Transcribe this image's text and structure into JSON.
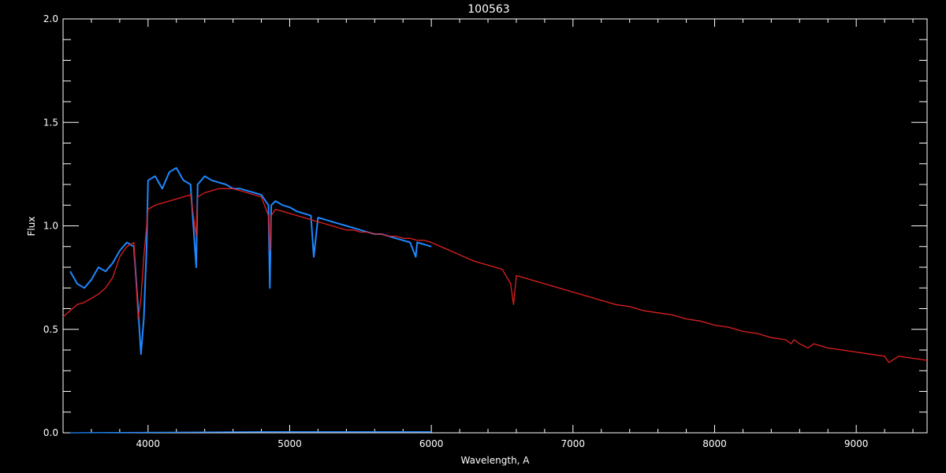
{
  "chart_data": {
    "type": "line",
    "title": "100563",
    "xlabel": "Wavelength, A",
    "ylabel": "Flux",
    "xlim": [
      3400,
      9500
    ],
    "ylim": [
      0.0,
      2.0
    ],
    "xticks": [
      4000,
      5000,
      6000,
      7000,
      8000,
      9000
    ],
    "xtick_labels": [
      "4000",
      "5000",
      "6000",
      "7000",
      "8000",
      "9000"
    ],
    "yticks": [
      0.0,
      0.5,
      1.0,
      1.5,
      2.0
    ],
    "ytick_labels": [
      "0.0",
      "0.5",
      "1.0",
      "1.5",
      "2.0"
    ],
    "grid": false,
    "background": "#000000",
    "axis_color": "#ffffff",
    "series": [
      {
        "color": "#1e88ff",
        "style": "observed spectrum, noisy",
        "x": [
          3450,
          3500,
          3550,
          3600,
          3650,
          3700,
          3750,
          3800,
          3850,
          3900,
          3930,
          3950,
          3970,
          3990,
          4000,
          4050,
          4100,
          4150,
          4200,
          4250,
          4300,
          4340,
          4350,
          4400,
          4450,
          4500,
          4550,
          4600,
          4650,
          4700,
          4750,
          4800,
          4850,
          4860,
          4870,
          4900,
          4950,
          5000,
          5050,
          5100,
          5150,
          5170,
          5200,
          5250,
          5300,
          5350,
          5400,
          5450,
          5500,
          5550,
          5600,
          5650,
          5700,
          5750,
          5800,
          5850,
          5890,
          5900,
          5950,
          6000
        ],
        "y": [
          0.78,
          0.72,
          0.7,
          0.74,
          0.8,
          0.78,
          0.82,
          0.88,
          0.92,
          0.9,
          0.6,
          0.38,
          0.55,
          0.9,
          1.22,
          1.24,
          1.18,
          1.26,
          1.28,
          1.22,
          1.2,
          0.8,
          1.2,
          1.24,
          1.22,
          1.21,
          1.2,
          1.18,
          1.18,
          1.17,
          1.16,
          1.15,
          1.1,
          0.7,
          1.1,
          1.12,
          1.1,
          1.09,
          1.07,
          1.06,
          1.05,
          0.85,
          1.04,
          1.03,
          1.02,
          1.01,
          1.0,
          0.99,
          0.98,
          0.97,
          0.96,
          0.96,
          0.95,
          0.94,
          0.93,
          0.92,
          0.85,
          0.92,
          0.91,
          0.9
        ]
      },
      {
        "color": "#e02020",
        "style": "model spectrum",
        "x": [
          3400,
          3450,
          3500,
          3550,
          3600,
          3650,
          3700,
          3750,
          3800,
          3850,
          3900,
          3930,
          3950,
          3970,
          3990,
          4000,
          4050,
          4100,
          4150,
          4200,
          4250,
          4300,
          4340,
          4350,
          4400,
          4450,
          4500,
          4550,
          4600,
          4650,
          4700,
          4750,
          4800,
          4850,
          4860,
          4870,
          4900,
          4950,
          5000,
          5050,
          5100,
          5150,
          5200,
          5250,
          5300,
          5350,
          5400,
          5450,
          5500,
          5550,
          5600,
          5650,
          5700,
          5750,
          5800,
          5850,
          5900,
          5950,
          6000,
          6100,
          6200,
          6300,
          6400,
          6500,
          6560,
          6580,
          6600,
          6700,
          6800,
          6900,
          7000,
          7100,
          7200,
          7300,
          7400,
          7500,
          7600,
          7700,
          7800,
          7900,
          8000,
          8100,
          8200,
          8300,
          8400,
          8500,
          8540,
          8560,
          8600,
          8660,
          8700,
          8800,
          8900,
          9000,
          9100,
          9200,
          9230,
          9300,
          9400,
          9500
        ],
        "y": [
          0.56,
          0.59,
          0.62,
          0.63,
          0.65,
          0.67,
          0.7,
          0.75,
          0.85,
          0.9,
          0.92,
          0.55,
          0.65,
          0.85,
          1.0,
          1.08,
          1.1,
          1.11,
          1.12,
          1.13,
          1.14,
          1.15,
          0.95,
          1.14,
          1.16,
          1.17,
          1.18,
          1.18,
          1.18,
          1.17,
          1.16,
          1.15,
          1.14,
          1.05,
          0.88,
          1.05,
          1.08,
          1.07,
          1.06,
          1.05,
          1.04,
          1.03,
          1.02,
          1.01,
          1.0,
          0.99,
          0.98,
          0.98,
          0.97,
          0.97,
          0.96,
          0.96,
          0.95,
          0.95,
          0.94,
          0.94,
          0.93,
          0.93,
          0.92,
          0.89,
          0.86,
          0.83,
          0.81,
          0.79,
          0.72,
          0.62,
          0.76,
          0.74,
          0.72,
          0.7,
          0.68,
          0.66,
          0.64,
          0.62,
          0.61,
          0.59,
          0.58,
          0.57,
          0.55,
          0.54,
          0.52,
          0.51,
          0.49,
          0.48,
          0.46,
          0.45,
          0.43,
          0.45,
          0.43,
          0.41,
          0.43,
          0.41,
          0.4,
          0.39,
          0.38,
          0.37,
          0.34,
          0.37,
          0.36,
          0.35
        ]
      },
      {
        "color": "#1e88ff",
        "style": "error spectrum",
        "x": [
          3450,
          4800,
          5000,
          6000
        ],
        "y": [
          0.0,
          0.005,
          0.005,
          0.005
        ]
      }
    ]
  }
}
